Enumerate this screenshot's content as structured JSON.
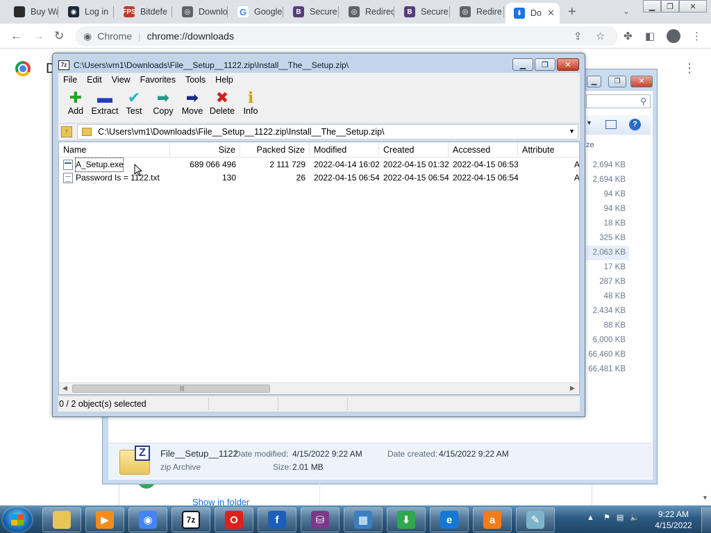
{
  "browser": {
    "tabs": [
      {
        "label": "Buy Wa",
        "favicon": "site-icon",
        "color": "#2b2b2b",
        "glyph": ""
      },
      {
        "label": "Log in",
        "favicon": "steam-icon",
        "color": "#1b2838",
        "glyph": "◉"
      },
      {
        "label": "Bitdefe",
        "favicon": "fps-icon",
        "color": "#c0392b",
        "glyph": "FPS"
      },
      {
        "label": "Downlo",
        "favicon": "globe-icon",
        "color": "#5f6368",
        "glyph": "◎"
      },
      {
        "label": "Google",
        "favicon": "google-icon",
        "color": "#ffffff",
        "glyph": "G"
      },
      {
        "label": "Secure",
        "favicon": "b-icon",
        "color": "#563d7c",
        "glyph": "B"
      },
      {
        "label": "Redirec",
        "favicon": "globe-icon",
        "color": "#5f6368",
        "glyph": "◎"
      },
      {
        "label": "Secure",
        "favicon": "b-icon",
        "color": "#563d7c",
        "glyph": "B"
      },
      {
        "label": "Redire",
        "favicon": "globe-icon",
        "color": "#5f6368",
        "glyph": "◎"
      },
      {
        "label": "Do",
        "favicon": "download-icon",
        "color": "#1a73e8",
        "glyph": "⬇",
        "active": true
      }
    ],
    "omnibox": {
      "chip": "Chrome",
      "url": "chrome://downloads"
    }
  },
  "downloads_page": {
    "heading_fragment": "D",
    "show_in_folder": "Show in folder"
  },
  "explorer": {
    "column_fragment": "ze",
    "sizes": [
      "2,694 KB",
      "2,694 KB",
      "94 KB",
      "94 KB",
      "18 KB",
      "325 KB",
      "2,063 KB",
      "17 KB",
      "287 KB",
      "48 KB",
      "2,434 KB",
      "88 KB",
      "6,000 KB",
      "66,460 KB",
      "66,481 KB"
    ],
    "selected_index": 6,
    "details": {
      "name": "File__Setup__1122",
      "type": "zip Archive",
      "modified_label": "Date modified:",
      "modified": "4/15/2022 9:22 AM",
      "created_label": "Date created:",
      "created": "4/15/2022 9:22 AM",
      "size_label": "Size:",
      "size": "2.01 MB"
    }
  },
  "sevenzip": {
    "title": "C:\\Users\\vm1\\Downloads\\File__Setup__1122.zip\\Install__The__Setup.zip\\",
    "menu": [
      "File",
      "Edit",
      "View",
      "Favorites",
      "Tools",
      "Help"
    ],
    "toolbar": [
      {
        "label": "Add",
        "icon": "plus-icon",
        "glyph": "✚",
        "color": "#1ea81e"
      },
      {
        "label": "Extract",
        "icon": "minus-icon",
        "glyph": "▬",
        "color": "#1f3fbf"
      },
      {
        "label": "Test",
        "icon": "check-icon",
        "glyph": "✔",
        "color": "#1cb8c4"
      },
      {
        "label": "Copy",
        "icon": "copy-arrow-icon",
        "glyph": "➡",
        "color": "#1d9a8a"
      },
      {
        "label": "Move",
        "icon": "move-arrow-icon",
        "glyph": "➡",
        "color": "#1a2a8c"
      },
      {
        "label": "Delete",
        "icon": "delete-x-icon",
        "glyph": "✖",
        "color": "#d41f1f"
      },
      {
        "label": "Info",
        "icon": "info-icon",
        "glyph": "ℹ",
        "color": "#c9a600"
      }
    ],
    "address": "C:\\Users\\vm1\\Downloads\\File__Setup__1122.zip\\Install__The__Setup.zip\\",
    "columns": {
      "name": "Name",
      "size": "Size",
      "packed": "Packed Size",
      "modified": "Modified",
      "created": "Created",
      "accessed": "Accessed",
      "attributes": "Attribute"
    },
    "rows": [
      {
        "name": "A_Setup.exe",
        "size": "689 066 496",
        "packed": "2 111 729",
        "modified": "2022-04-14 16:02",
        "created": "2022-04-15 01:32",
        "accessed": "2022-04-15 06:53",
        "attr": "A",
        "icon": "exe-file-icon"
      },
      {
        "name": "Password Is =   1122.txt",
        "size": "130",
        "packed": "26",
        "modified": "2022-04-15 06:54",
        "created": "2022-04-15 06:54",
        "accessed": "2022-04-15 06:54",
        "attr": "A",
        "icon": "text-file-icon"
      }
    ],
    "status": "0 / 2 object(s) selected"
  },
  "taskbar": {
    "apps": [
      {
        "name": "explorer",
        "icon": "folder-icon",
        "color": "#e9c557",
        "glyph": ""
      },
      {
        "name": "media-player",
        "icon": "media-player-icon",
        "color": "#f28c1e",
        "glyph": "▶"
      },
      {
        "name": "chrome",
        "icon": "chrome-icon",
        "color": "#4285f4",
        "glyph": "◉"
      },
      {
        "name": "7zip",
        "icon": "7zip-icon",
        "color": "#111111",
        "glyph": "7z"
      },
      {
        "name": "opera",
        "icon": "opera-icon",
        "color": "#e0201a",
        "glyph": "O"
      },
      {
        "name": "facebook",
        "icon": "facebook-icon",
        "color": "#1c5fb8",
        "glyph": "f"
      },
      {
        "name": "winrar",
        "icon": "winrar-icon",
        "color": "#7b3a8c",
        "glyph": "⛁"
      },
      {
        "name": "control-panel",
        "icon": "control-panel-icon",
        "color": "#3b7fc2",
        "glyph": "▦"
      },
      {
        "name": "download-manager",
        "icon": "download-manager-icon",
        "color": "#2fa84f",
        "glyph": "⬇"
      },
      {
        "name": "edge",
        "icon": "edge-icon",
        "color": "#1478d4",
        "glyph": "e"
      },
      {
        "name": "avast",
        "icon": "avast-icon",
        "color": "#f07d1a",
        "glyph": "a"
      },
      {
        "name": "notepad",
        "icon": "notepad-icon",
        "color": "#7fb3c9",
        "glyph": "✎"
      }
    ],
    "clock_time": "9:22 AM",
    "clock_date": "4/15/2022"
  }
}
